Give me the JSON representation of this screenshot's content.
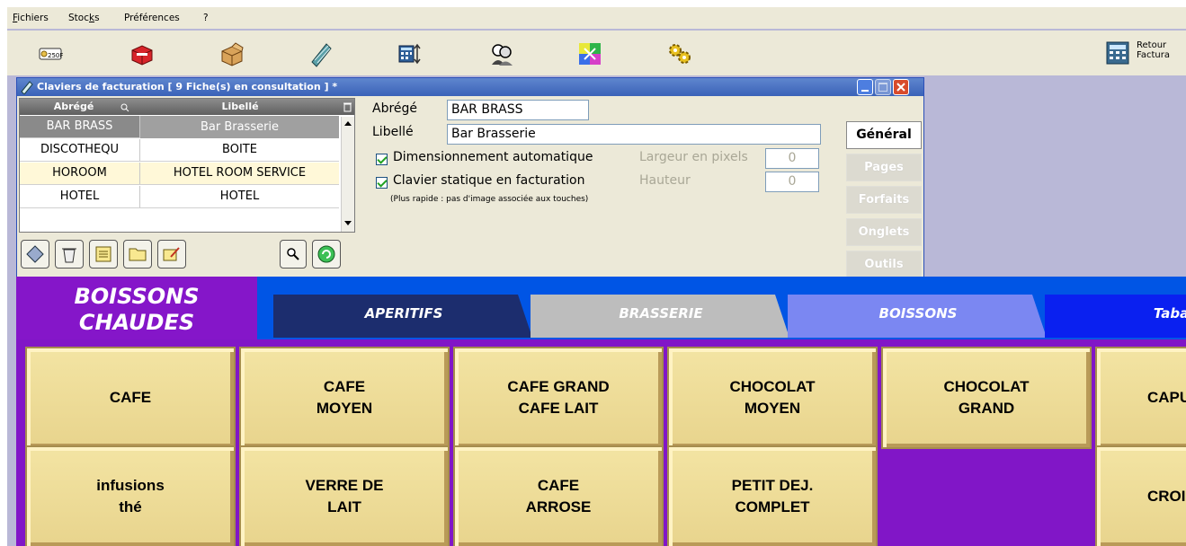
{
  "menubar": {
    "items": [
      {
        "label": "Fichiers",
        "underline": "F"
      },
      {
        "label": "Stocks",
        "underline": "k"
      },
      {
        "label": "Préférences",
        "underline": ""
      },
      {
        "label": "?",
        "underline": "?"
      }
    ]
  },
  "toolbar": {
    "buttons": [
      {
        "name": "euro-coin-icon",
        "text": "250F"
      },
      {
        "name": "red-box-icon"
      },
      {
        "name": "open-box-icon"
      },
      {
        "name": "keyboard-pencil-icon"
      },
      {
        "name": "calculator-sort-icon"
      },
      {
        "name": "users-icon"
      },
      {
        "name": "colored-grid-icon"
      },
      {
        "name": "gears-icon"
      }
    ],
    "retour_label_1": "Retour",
    "retour_label_2": "Factura"
  },
  "dialog": {
    "title": "Claviers de facturation  [ 9 Fiche(s) en consultation ] *",
    "grid": {
      "headers": [
        "Abrégé",
        "Libellé"
      ],
      "rows": [
        {
          "abrege": "BAR BRASS",
          "libelle": "Bar Brasserie",
          "state": "selected"
        },
        {
          "abrege": "DISCOTHEQU",
          "libelle": "BOITE",
          "state": "white"
        },
        {
          "abrege": "HOROOM",
          "libelle": "HOTEL ROOM SERVICE",
          "state": "cream"
        },
        {
          "abrege": "HOTEL",
          "libelle": "HOTEL",
          "state": "white"
        }
      ]
    },
    "form": {
      "abrege_label": "Abrégé",
      "abrege_value": "BAR BRASS",
      "libelle_label": "Libellé",
      "libelle_value": "Bar Brasserie",
      "dimension_label": "Dimensionnement automatique",
      "dimension_checked": true,
      "largeur_label": "Largeur en pixels",
      "largeur_value": "0",
      "statique_label": "Clavier statique en facturation",
      "statique_checked": true,
      "hauteur_label": "Hauteur",
      "hauteur_value": "0",
      "note": "(Plus rapide : pas d'image associée aux touches)"
    },
    "side_tabs": [
      "Général",
      "Pages",
      "Forfaits",
      "Onglets",
      "Outils"
    ]
  },
  "keyboard": {
    "active_tab": "BOISSONS CHAUDES",
    "tabs": [
      {
        "label": "APERITIFS",
        "color": "#1c2d6e",
        "text_color": "#ffffff"
      },
      {
        "label": "BRASSERIE",
        "color": "#bdbdbd",
        "text_color": "#ffffff"
      },
      {
        "label": "BOISSONS",
        "color": "#7b87f2",
        "text_color": "#ffffff"
      },
      {
        "label": "Tabac",
        "color": "#0a20f0",
        "text_color": "#ffffff"
      }
    ],
    "keys_row1": [
      "CAFE",
      "CAFE\nMOYEN",
      "CAFE GRAND\nCAFE LAIT",
      "CHOCOLAT\nMOYEN",
      "CHOCOLAT\nGRAND",
      "CAPUCCINO"
    ],
    "keys_row2": [
      "infusions\nthé",
      "VERRE DE\nLAIT",
      "CAFE\nARROSE",
      "PETIT DEJ.\nCOMPLET",
      "",
      "CROISSANT"
    ]
  }
}
